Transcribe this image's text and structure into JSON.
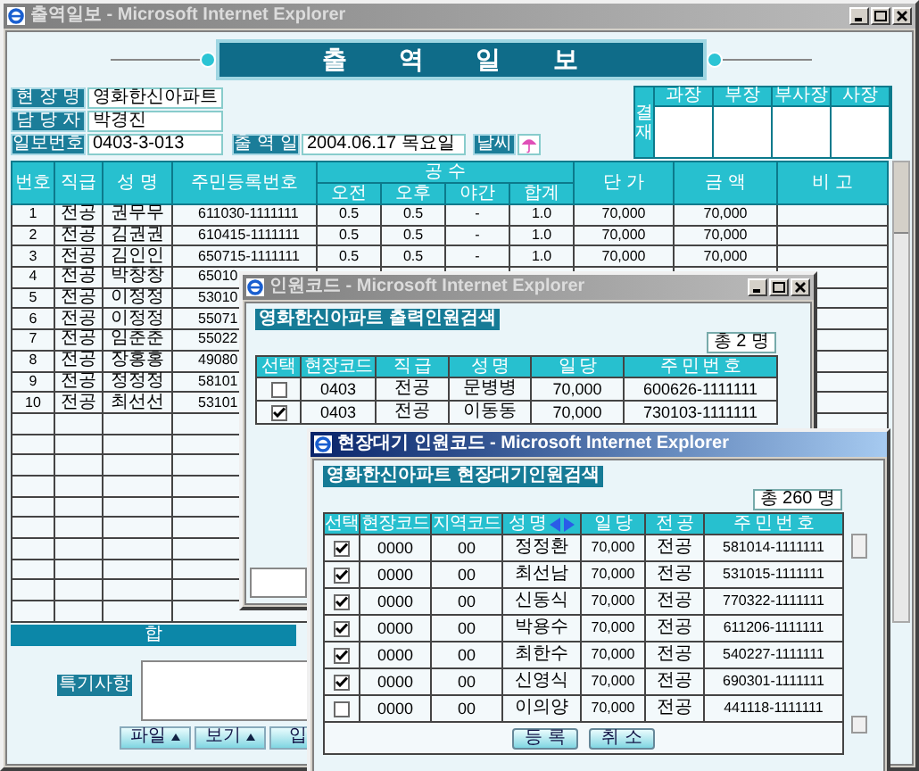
{
  "main_window": {
    "title": "출역일보 - Microsoft Internet Explorer",
    "active": false,
    "controls_visible": true
  },
  "report_title": "출 역 일 보",
  "fields": [
    {
      "label": "현 장 명",
      "value": "영화한신아파트"
    },
    {
      "label": "담 당 자",
      "value": "박경진"
    },
    {
      "label": "일보번호",
      "value": "0403-3-013"
    }
  ],
  "work_date": {
    "label": "출 역 일",
    "value": "2004.06.17 목요일"
  },
  "weather": {
    "label": "날씨"
  },
  "approval": {
    "label": "결재",
    "columns": [
      "과장",
      "부장",
      "부사장",
      "사장"
    ]
  },
  "table": {
    "column_group": {
      "label": "공 수"
    },
    "columns": [
      {
        "label": "번호",
        "in_group": false
      },
      {
        "label": "직급",
        "in_group": false
      },
      {
        "label": "성 명",
        "in_group": false
      },
      {
        "label": "주민등록번호",
        "in_group": false
      },
      {
        "label": "오전",
        "in_group": true
      },
      {
        "label": "오후",
        "in_group": true
      },
      {
        "label": "야간",
        "in_group": true
      },
      {
        "label": "합계",
        "in_group": true
      },
      {
        "label": "단 가",
        "in_group": false
      },
      {
        "label": "금 액",
        "in_group": false
      },
      {
        "label": "비 고",
        "in_group": false
      }
    ],
    "rows": [
      {
        "cells": [
          "1",
          "전공",
          "권무무",
          "611030-1111111",
          "0.5",
          "0.5",
          "-",
          "1.0",
          "70,000",
          "70,000"
        ]
      },
      {
        "cells": [
          "2",
          "전공",
          "김권권",
          "610415-1111111",
          "0.5",
          "0.5",
          "-",
          "1.0",
          "70,000",
          "70,000"
        ]
      },
      {
        "cells": [
          "3",
          "전공",
          "김인인",
          "650715-1111111",
          "0.5",
          "0.5",
          "-",
          "1.0",
          "70,000",
          "70,000"
        ]
      },
      {
        "cells": [
          "4",
          "전공",
          "박창창",
          "65010"
        ]
      },
      {
        "cells": [
          "5",
          "전공",
          "이정정",
          "53010"
        ]
      },
      {
        "cells": [
          "6",
          "전공",
          "이정정",
          "55071"
        ]
      },
      {
        "cells": [
          "7",
          "전공",
          "임춘춘",
          "55022"
        ]
      },
      {
        "cells": [
          "8",
          "전공",
          "장홍홍",
          "49080"
        ]
      },
      {
        "cells": [
          "9",
          "전공",
          "정정정",
          "58101"
        ]
      },
      {
        "cells": [
          "10",
          "전공",
          "최선선",
          "53101"
        ]
      }
    ]
  },
  "total_label": "합",
  "remarks_label": "특기사항",
  "buttons": [
    "파일",
    "보기",
    "입"
  ],
  "worker_popup": {
    "title": "인원코드 - Microsoft Internet Explorer",
    "active": false,
    "controls_visible": true,
    "heading": "영화한신아파트 출력인원검색",
    "count": "총 2 명",
    "select_header": "선택",
    "columns": [
      {
        "label": "현장코드"
      },
      {
        "label": "직 급"
      },
      {
        "label": "성 명"
      },
      {
        "label": "일 당"
      },
      {
        "label": "주 민 번 호"
      }
    ],
    "rows": [
      {
        "checked": false,
        "cells": [
          "0403",
          "전공",
          "문병병",
          "70,000",
          "600626-1111111"
        ]
      },
      {
        "checked": true,
        "cells": [
          "0403",
          "전공",
          "이동동",
          "70,000",
          "730103-1111111"
        ]
      }
    ]
  },
  "standby_popup": {
    "title": "현장대기 인원코드 - Microsoft Internet Explorer",
    "active": true,
    "controls_visible": false,
    "heading": "영화한신아파트 현장대기인원검색",
    "count": "총 260 명",
    "select_header": "선택",
    "columns": [
      {
        "label": "현장코드"
      },
      {
        "label": "지역코드"
      },
      {
        "label": "성 명",
        "sortable": true
      },
      {
        "label": "일 당"
      },
      {
        "label": "전 공"
      },
      {
        "label": "주 민 번 호"
      }
    ],
    "rows": [
      {
        "checked": true,
        "cells": [
          "0000",
          "00",
          "정정환",
          "70,000",
          "전공",
          "581014-1111111"
        ]
      },
      {
        "checked": true,
        "cells": [
          "0000",
          "00",
          "최선남",
          "70,000",
          "전공",
          "531015-1111111"
        ]
      },
      {
        "checked": true,
        "cells": [
          "0000",
          "00",
          "신동식",
          "70,000",
          "전공",
          "770322-1111111"
        ]
      },
      {
        "checked": true,
        "cells": [
          "0000",
          "00",
          "박용수",
          "70,000",
          "전공",
          "611206-1111111"
        ]
      },
      {
        "checked": true,
        "cells": [
          "0000",
          "00",
          "최한수",
          "70,000",
          "전공",
          "540227-1111111"
        ]
      },
      {
        "checked": true,
        "cells": [
          "0000",
          "00",
          "신영식",
          "70,000",
          "전공",
          "690301-1111111"
        ]
      },
      {
        "checked": false,
        "cells": [
          "0000",
          "00",
          "이의양",
          "70,000",
          "전공",
          "441118-1111111"
        ]
      }
    ],
    "buttons": [
      "등 록",
      "취 소"
    ]
  }
}
